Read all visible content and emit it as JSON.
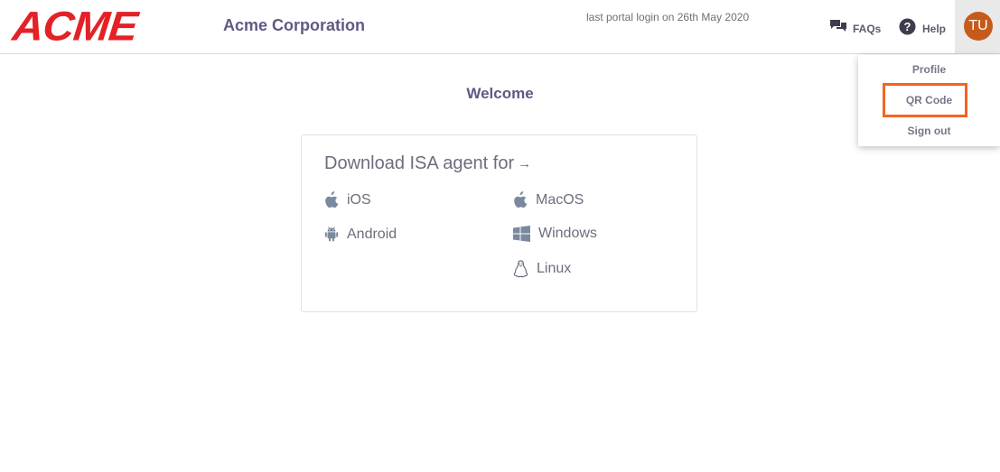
{
  "header": {
    "logo": "ACME",
    "company": "Acme Corporation",
    "last_login": "last portal login on 26th May 2020",
    "faqs_label": "FAQs",
    "help_label": "Help",
    "avatar_initials": "TU"
  },
  "user_menu": {
    "items": [
      {
        "label": "Profile"
      },
      {
        "label": "QR Code"
      },
      {
        "label": "Sign out"
      }
    ]
  },
  "main": {
    "welcome": "Welcome",
    "download": {
      "title": "Download ISA agent for",
      "arrow": "→",
      "platforms": [
        {
          "label": "iOS",
          "icon": "apple-icon"
        },
        {
          "label": "Android",
          "icon": "android-icon"
        },
        {
          "label": "MacOS",
          "icon": "apple-icon"
        },
        {
          "label": "Windows",
          "icon": "windows-icon"
        },
        {
          "label": "Linux",
          "icon": "linux-icon"
        }
      ]
    }
  },
  "colors": {
    "logo_red": "#e32126",
    "brand_purple": "#5e5a86",
    "avatar_orange": "#c65a1b",
    "highlight_orange": "#f26522",
    "icon_gray": "#7a8a9e"
  }
}
